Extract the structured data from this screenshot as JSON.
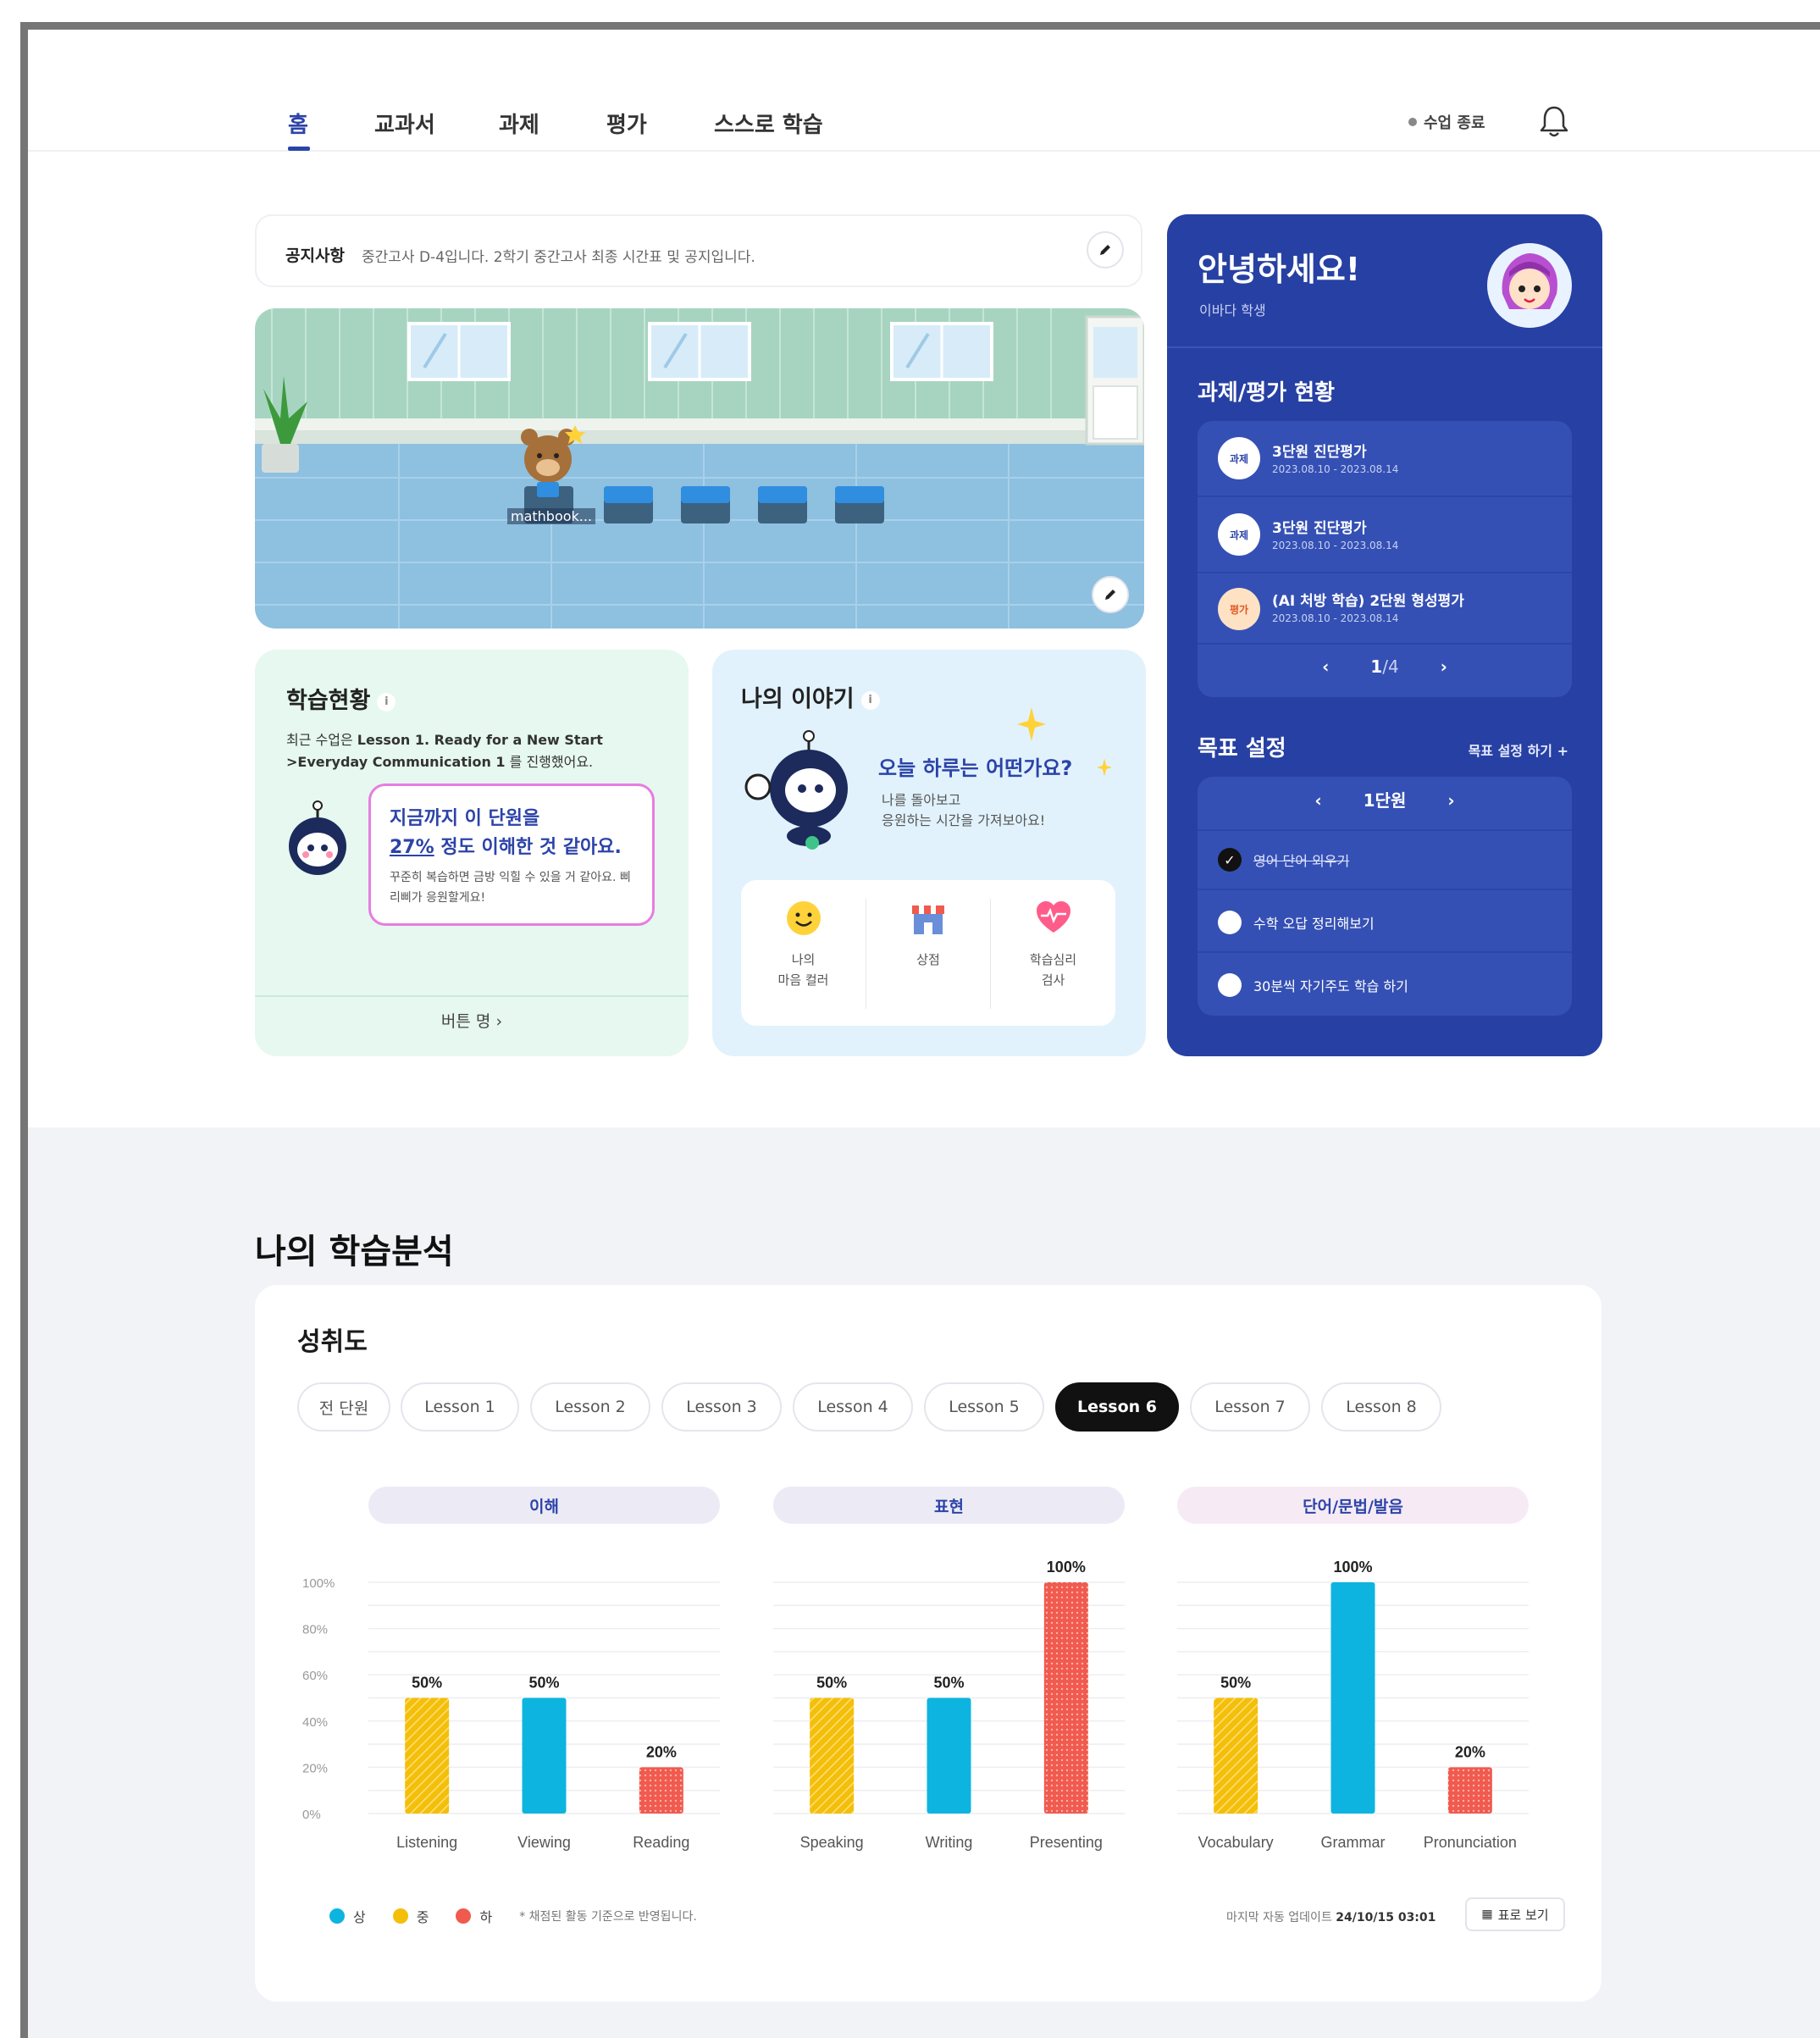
{
  "nav": {
    "tabs": [
      "홈",
      "교과서",
      "과제",
      "평가",
      "스스로 학습"
    ],
    "end_class": "수업 종료"
  },
  "notice": {
    "label": "공지사항",
    "text": "중간고사 D-4입니다. 2학기 중간고사 최종 시간표 및 공지입니다."
  },
  "classroom": {
    "sign": "mathbook..."
  },
  "study": {
    "title": "학습현황",
    "desc_prefix": "최근 수업은",
    "lesson": "Lesson 1. Ready for a New Start",
    "lesson2": ">Everyday Communication 1",
    "desc_suffix": "를 진행했어요.",
    "bubble_line1": "지금까지 이 단원을",
    "bubble_percent": "27%",
    "bubble_line2_rest": " 정도 이해한 것 같아요.",
    "bubble_small": "꾸준히 복습하면 금방 익힐 수 있을 거 같아요. 삐리삐가 응원할게요!",
    "button": "버튼 명"
  },
  "story": {
    "title": "나의 이야기",
    "headline": "오늘 하루는 어떤가요?",
    "sub1": "나를 돌아보고",
    "sub2": "응원하는 시간을 가져보아요!",
    "items": [
      {
        "icon": "smile-icon",
        "label1": "나의",
        "label2": "마음 컬러"
      },
      {
        "icon": "shop-icon",
        "label1": "상점",
        "label2": ""
      },
      {
        "icon": "heart-icon",
        "label1": "학습심리",
        "label2": "검사"
      }
    ]
  },
  "profile": {
    "greeting": "안녕하세요!",
    "name": "이바다 학생",
    "status_title": "과제/평가 현황",
    "tasks": [
      {
        "badge": "과제",
        "title": "3단원 진단평가",
        "date": "2023.08.10 - 2023.08.14"
      },
      {
        "badge": "과제",
        "title": "3단원 진단평가",
        "date": "2023.08.10 - 2023.08.14"
      },
      {
        "badge": "평가",
        "title": "(AI 처방 학습) 2단원 형성평가",
        "date": "2023.08.10 - 2023.08.14"
      }
    ],
    "page": "1",
    "page_total": "/4",
    "goal_title": "목표 설정",
    "goal_action": "목표 설정 하기 +",
    "unit": "1단원",
    "goals": [
      {
        "text": "영어 단어 외우기",
        "done": true
      },
      {
        "text": "수학 오답 정리해보기",
        "done": false
      },
      {
        "text": "30분씩 자기주도 학습 하기",
        "done": false
      }
    ]
  },
  "analysis": {
    "section_title": "나의 학습분석",
    "card_title": "성취도",
    "filters": [
      "전 단원",
      "Lesson 1",
      "Lesson 2",
      "Lesson 3",
      "Lesson 4",
      "Lesson 5",
      "Lesson 6",
      "Lesson 7",
      "Lesson 8"
    ],
    "selected_filter": "Lesson 6",
    "legend": [
      {
        "label": "상",
        "color": "#0db4e0"
      },
      {
        "label": "중",
        "color": "#f4bf0a"
      },
      {
        "label": "하",
        "color": "#f05a4f"
      }
    ],
    "legend_note": "* 채점된 활동 기준으로 반영됩니다.",
    "updated_label": "마지막 자동 업데이트",
    "updated_time": "24/10/15 03:01",
    "table_button": "표로 보기"
  },
  "chart_data": {
    "type": "bar",
    "ylim": [
      0,
      100
    ],
    "yticks": [
      "100%",
      "80%",
      "60%",
      "40%",
      "20%",
      "0%"
    ],
    "groups": [
      {
        "name": "이해",
        "categories": [
          "Listening",
          "Viewing",
          "Reading"
        ],
        "values": [
          50,
          50,
          20
        ],
        "levels": [
          "중",
          "상",
          "하"
        ]
      },
      {
        "name": "표현",
        "categories": [
          "Speaking",
          "Writing",
          "Presenting"
        ],
        "values": [
          50,
          50,
          100
        ],
        "levels": [
          "중",
          "상",
          "하"
        ]
      },
      {
        "name": "단어/문법/발음",
        "categories": [
          "Vocabulary",
          "Grammar",
          "Pronunciation"
        ],
        "values": [
          50,
          100,
          20
        ],
        "levels": [
          "중",
          "상",
          "하"
        ]
      }
    ],
    "level_colors": {
      "상": "#0db4e0",
      "중": "#f4bf0a",
      "하": "#f05a4f"
    }
  }
}
